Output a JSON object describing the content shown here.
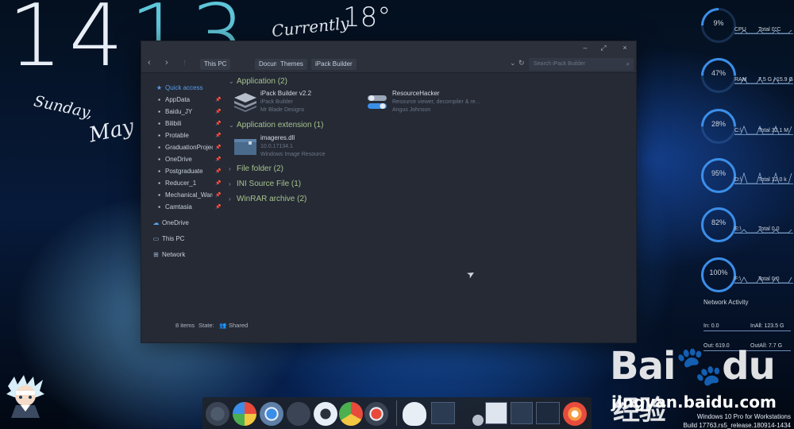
{
  "desktop": {
    "clock_hours": "14",
    "clock_minutes": "13",
    "weekday": "Sunday,",
    "month": "May",
    "weather_label": "Currently",
    "temperature": "18°"
  },
  "window": {
    "controls": {
      "minimize": "–",
      "maximize": "⤢",
      "close": "×"
    },
    "breadcrumbs": [
      "This PC",
      "Themes",
      "Documents",
      "iPack Builder"
    ],
    "search_placeholder": "Search iPack Builder",
    "sidebar": [
      {
        "label": "Quick access",
        "icon": "star-icon",
        "pinned": false
      },
      {
        "label": "AppData",
        "icon": "folder-icon",
        "pinned": true
      },
      {
        "label": "Baidu_JY",
        "icon": "folder-icon",
        "pinned": true
      },
      {
        "label": "Bilibili",
        "icon": "folder-icon",
        "pinned": true
      },
      {
        "label": "Protable",
        "icon": "folder-icon",
        "pinned": true
      },
      {
        "label": "GraduationProject",
        "icon": "folder-icon",
        "pinned": true
      },
      {
        "label": "OneDrive",
        "icon": "folder-icon",
        "pinned": true
      },
      {
        "label": "Postgraduate",
        "icon": "folder-icon",
        "pinned": true
      },
      {
        "label": "Reducer_1",
        "icon": "folder-icon",
        "pinned": true
      },
      {
        "label": "Mechanical_Ware",
        "icon": "folder-icon",
        "pinned": true
      },
      {
        "label": "Camtasia",
        "icon": "folder-icon",
        "pinned": true
      },
      {
        "label": "OneDrive",
        "icon": "cloud-icon",
        "pinned": false
      },
      {
        "label": "This PC",
        "icon": "monitor-icon",
        "pinned": false
      },
      {
        "label": "Network",
        "icon": "network-icon",
        "pinned": false
      }
    ],
    "groups": [
      {
        "title": "Application (2)",
        "expanded": true
      },
      {
        "title": "Application extension (1)",
        "expanded": true
      },
      {
        "title": "File folder (2)",
        "expanded": false
      },
      {
        "title": "INI Source File (1)",
        "expanded": false
      },
      {
        "title": "WinRAR archive (2)",
        "expanded": false
      }
    ],
    "files": [
      {
        "name": "iPack Builder v2.2",
        "line2": "iPack Builder",
        "line3": "Mr Blade Designs"
      },
      {
        "name": "ResourceHacker",
        "line2": "Resource viewer, decompiler & re...",
        "line3": "Angus Johnson"
      },
      {
        "name": "imageres.dll",
        "line2": "10.0.17134.1",
        "line3": "Windows Image Resource"
      }
    ],
    "status": {
      "count": "8 items",
      "state_label": "State:",
      "state_value": "Shared"
    }
  },
  "monitor": [
    {
      "pct": "9%",
      "label": "CPU",
      "total": "Total 0°C",
      "level": 9
    },
    {
      "pct": "47%",
      "label": "RAM",
      "total": "7.5 G / 15.9 G",
      "level": 47
    },
    {
      "pct": "28%",
      "label": "C:\\",
      "total": "Total 32.1 M",
      "level": 28
    },
    {
      "pct": "95%",
      "label": "D:\\",
      "total": "Total 12.0 k",
      "level": 95
    },
    {
      "pct": "82%",
      "label": "E:\\",
      "total": "Total 0.0",
      "level": 82
    },
    {
      "pct": "100%",
      "label": "F:\\",
      "total": "Total 0.0",
      "level": 100
    }
  ],
  "network": {
    "title": "Network Activity",
    "in": "In: 0.0",
    "in_all": "InAll: 123.5 G",
    "out": "Out: 619.0",
    "out_all": "OutAll: 7.7 G"
  },
  "watermark": {
    "brand": "Bai",
    "brand2": "du",
    "cn": "经验",
    "url": "jingyan.baidu.com"
  },
  "os": {
    "edition": "Windows 10 Pro for Workstations",
    "build": "Build 17763.rs5_release.180914-1434"
  },
  "colors": {
    "accent": "#3b8ee8",
    "group_header": "#a7c28c",
    "window_bg": "#252a35"
  }
}
